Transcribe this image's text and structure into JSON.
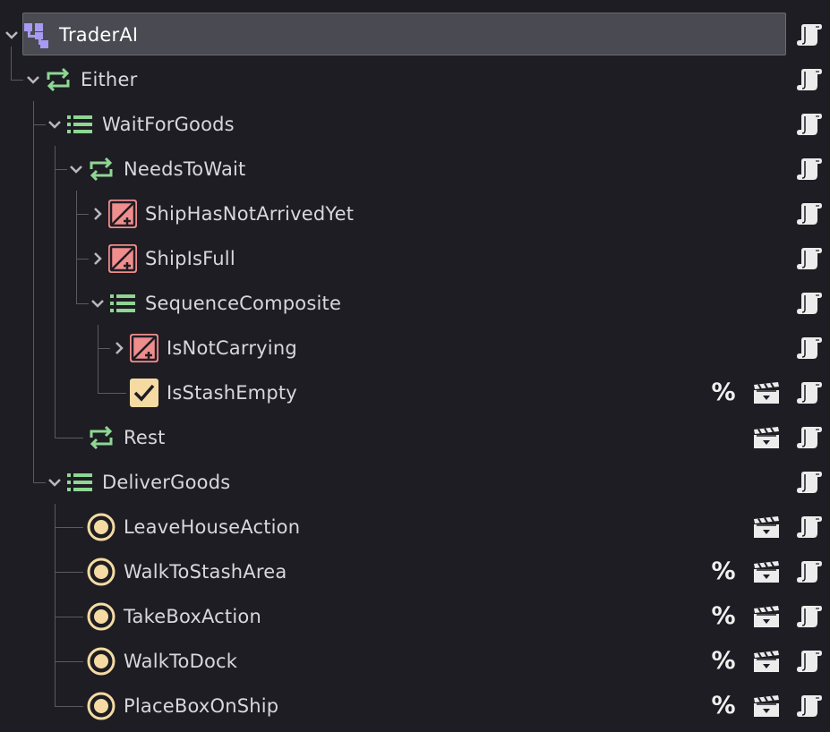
{
  "tree": {
    "rows": [
      {
        "label": "TraderAI",
        "icon": "behavior-tree-icon",
        "expand": "expanded",
        "selected": true,
        "actions": [
          "script"
        ]
      },
      {
        "label": "Either",
        "icon": "selector-icon",
        "expand": "expanded",
        "actions": [
          "script"
        ]
      },
      {
        "label": "WaitForGoods",
        "icon": "sequence-icon",
        "expand": "expanded",
        "actions": [
          "script"
        ]
      },
      {
        "label": "NeedsToWait",
        "icon": "selector-icon",
        "expand": "expanded",
        "actions": [
          "script"
        ]
      },
      {
        "label": "ShipHasNotArrivedYet",
        "icon": "decorator-icon",
        "expand": "collapsed",
        "actions": [
          "script"
        ]
      },
      {
        "label": "ShipIsFull",
        "icon": "decorator-icon",
        "expand": "collapsed",
        "actions": [
          "script"
        ]
      },
      {
        "label": "SequenceComposite",
        "icon": "sequence-icon",
        "expand": "expanded",
        "actions": [
          "script"
        ]
      },
      {
        "label": "IsNotCarrying",
        "icon": "decorator-icon",
        "expand": "collapsed",
        "actions": [
          "script"
        ]
      },
      {
        "label": "IsStashEmpty",
        "icon": "condition-icon",
        "expand": "none",
        "actions": [
          "percent",
          "clapper",
          "script"
        ]
      },
      {
        "label": "Rest",
        "icon": "selector-icon",
        "expand": "none",
        "actions": [
          "clapper",
          "script"
        ]
      },
      {
        "label": "DeliverGoods",
        "icon": "sequence-icon",
        "expand": "expanded",
        "actions": [
          "script"
        ]
      },
      {
        "label": "LeaveHouseAction",
        "icon": "action-icon",
        "expand": "none",
        "actions": [
          "clapper",
          "script"
        ]
      },
      {
        "label": "WalkToStashArea",
        "icon": "action-icon",
        "expand": "none",
        "actions": [
          "percent",
          "clapper",
          "script"
        ]
      },
      {
        "label": "TakeBoxAction",
        "icon": "action-icon",
        "expand": "none",
        "actions": [
          "percent",
          "clapper",
          "script"
        ]
      },
      {
        "label": "WalkToDock",
        "icon": "action-icon",
        "expand": "none",
        "actions": [
          "percent",
          "clapper",
          "script"
        ]
      },
      {
        "label": "PlaceBoxOnShip",
        "icon": "action-icon",
        "expand": "none",
        "actions": [
          "percent",
          "clapper",
          "script"
        ]
      }
    ],
    "percent_label": "%"
  },
  "colors": {
    "background": "#1d1d23",
    "selection": "#4a4a52",
    "text": "#d8d8dc",
    "sequence_green": "#8fd694",
    "tree_purple": "#a79af0",
    "decorator_red": "#f08d8d",
    "condition_yellow": "#f5dba3",
    "action_yellow": "#f5dba3",
    "guide_line": "#5a5a62"
  }
}
